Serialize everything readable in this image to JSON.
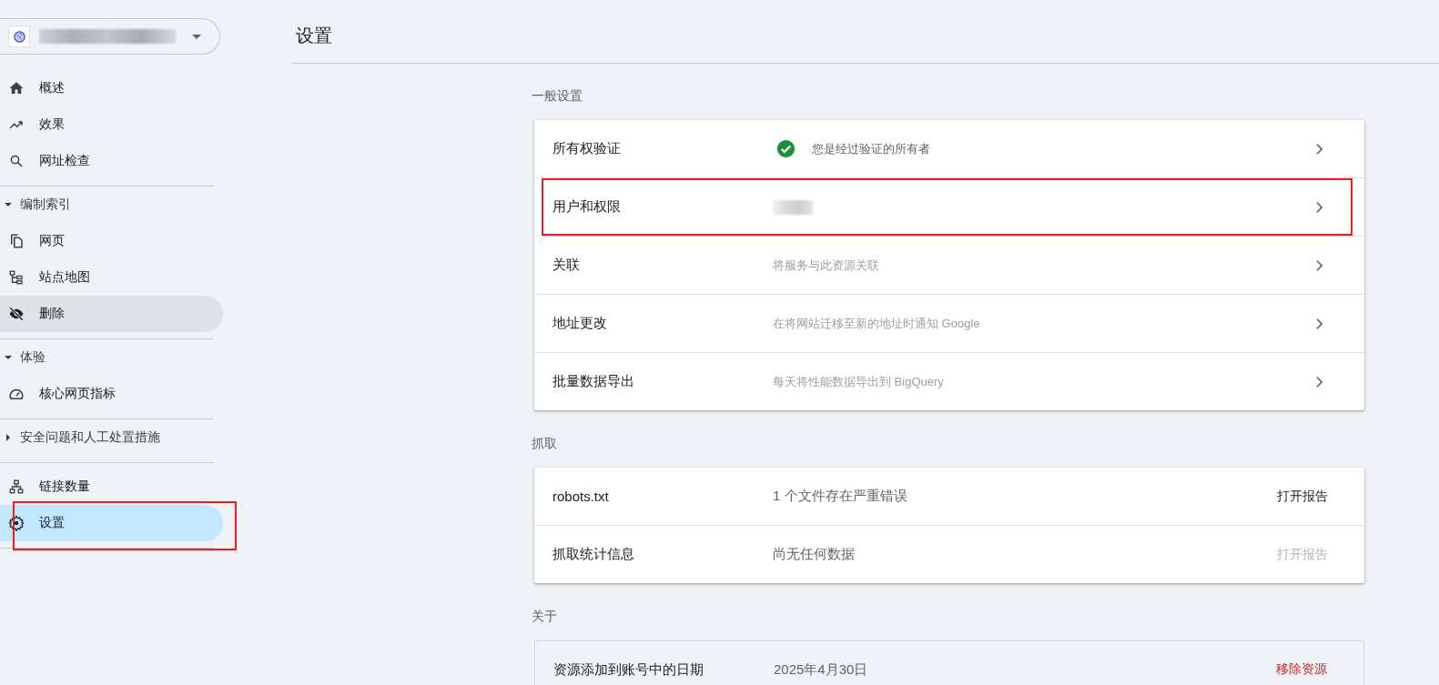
{
  "sidebar": {
    "groups": [
      {
        "items": [
          {
            "label": "概述",
            "selected": false,
            "hovered": false
          },
          {
            "label": "效果",
            "selected": false,
            "hovered": false
          },
          {
            "label": "网址检查",
            "selected": false,
            "hovered": false
          }
        ]
      },
      {
        "header": {
          "label": "编制索引",
          "expanded": true
        },
        "items": [
          {
            "label": "网页",
            "selected": false,
            "hovered": false
          },
          {
            "label": "站点地图",
            "selected": false,
            "hovered": false
          },
          {
            "label": "删除",
            "selected": false,
            "hovered": true
          }
        ]
      },
      {
        "header": {
          "label": "体验",
          "expanded": true
        },
        "items": [
          {
            "label": "核心网页指标",
            "selected": false,
            "hovered": false
          }
        ]
      },
      {
        "header": {
          "label": "安全问题和人工处置措施",
          "expanded": false
        }
      },
      {
        "items": [
          {
            "label": "链接数量",
            "selected": false,
            "hovered": false
          },
          {
            "label": "设置",
            "selected": true,
            "hovered": false,
            "annotated": true
          }
        ]
      }
    ]
  },
  "main": {
    "title": "设置",
    "sections": [
      {
        "label": "一般设置",
        "kind": "links",
        "rows": [
          {
            "label": "所有权验证",
            "value": "您是经过验证的所有者",
            "verified": true
          },
          {
            "label": "用户和权限",
            "redacted": true,
            "annotated": true
          },
          {
            "label": "关联",
            "value": "将服务与此资源关联"
          },
          {
            "label": "地址更改",
            "value": "在将网站迁移至新的地址时通知 Google"
          },
          {
            "label": "批量数据导出",
            "value": "每天将性能数据导出到 BigQuery"
          }
        ]
      },
      {
        "label": "抓取",
        "kind": "reports",
        "rows": [
          {
            "label": "robots.txt",
            "value": "1 个文件存在严重错误",
            "action": "打开报告",
            "disabled": false
          },
          {
            "label": "抓取统计信息",
            "value": "尚无任何数据",
            "action": "打开报告",
            "disabled": true
          }
        ]
      },
      {
        "label": "关于",
        "kind": "about",
        "rows": [
          {
            "label": "资源添加到账号中的日期",
            "value": "2025年4月30日",
            "action": "移除资源"
          }
        ]
      }
    ]
  }
}
